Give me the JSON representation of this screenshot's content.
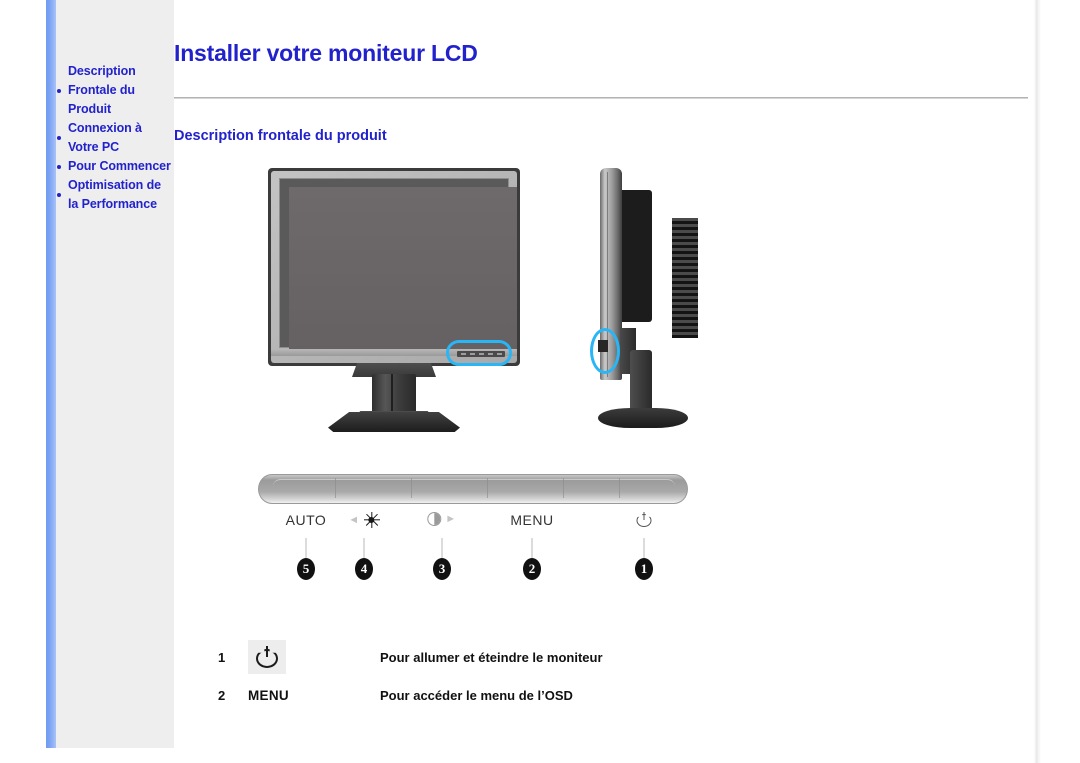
{
  "sidebar": {
    "items": [
      {
        "label": "Description Frontale du Produit",
        "bullet": "•"
      },
      {
        "label": "Connexion à Votre PC",
        "bullet": "•"
      },
      {
        "label": "Pour Commencer",
        "bullet": "•"
      },
      {
        "label": "Optimisation de la Performance",
        "bullet": "•"
      }
    ]
  },
  "content": {
    "page_title": "Installer votre moniteur LCD",
    "section_title": "Description frontale du produit"
  },
  "figure": {
    "front_view_name": "lcd-monitor-front-view",
    "side_view_name": "lcd-monitor-side-view",
    "highlight_color": "#29b6f6"
  },
  "controls": {
    "buttons": [
      {
        "label": "AUTO",
        "number": "5",
        "icon": "auto-label"
      },
      {
        "label": "",
        "number": "4",
        "icon": "brightness-sun-icon"
      },
      {
        "label": "",
        "number": "3",
        "icon": "contrast-half-circle-icon"
      },
      {
        "label": "MENU",
        "number": "2",
        "icon": "menu-label"
      },
      {
        "label": "",
        "number": "1",
        "icon": "power-icon"
      }
    ]
  },
  "table": {
    "rows": [
      {
        "number": "1",
        "control": "",
        "control_icon": "power-icon",
        "description": "Pour allumer et éteindre le moniteur"
      },
      {
        "number": "2",
        "control": "MENU",
        "control_icon": "",
        "description": "Pour accéder le menu de l’OSD"
      }
    ]
  },
  "colors": {
    "accent_blue": "#2222cc",
    "sidebar_bg": "#eeeeee",
    "stripe_blue": "#7ea4f3",
    "highlight_cyan": "#29b6f6"
  }
}
